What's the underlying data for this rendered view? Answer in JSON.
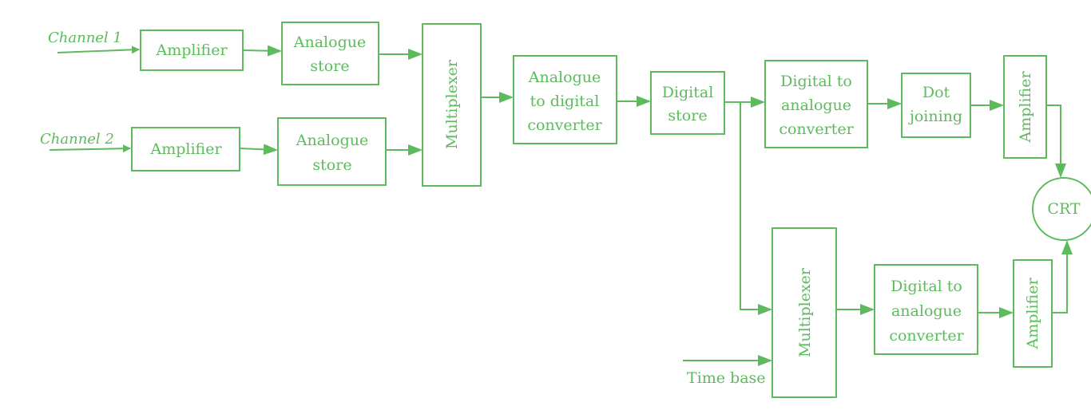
{
  "colors": {
    "ink": "#5dbb5d",
    "background": "#ffffff"
  },
  "inputs": {
    "channel1": "Channel 1",
    "channel2": "Channel 2",
    "time_base": "Time base"
  },
  "blocks": {
    "amp1": "Amplifier",
    "store1": [
      "Analogue",
      "store"
    ],
    "amp2": "Amplifier",
    "store2": [
      "Analogue",
      "store"
    ],
    "mux1": "Multiplexer",
    "adc": [
      "Analogue",
      "to digital",
      "converter"
    ],
    "dstore": [
      "Digital",
      "store"
    ],
    "dac1": [
      "Digital to",
      "analogue",
      "converter"
    ],
    "dot": [
      "Dot",
      "joining"
    ],
    "amp_y": "Amplifier",
    "crt": "CRT",
    "mux2": "Multiplexer",
    "dac2": [
      "Digital to",
      "analogue",
      "converter"
    ],
    "amp_x": "Amplifier"
  }
}
